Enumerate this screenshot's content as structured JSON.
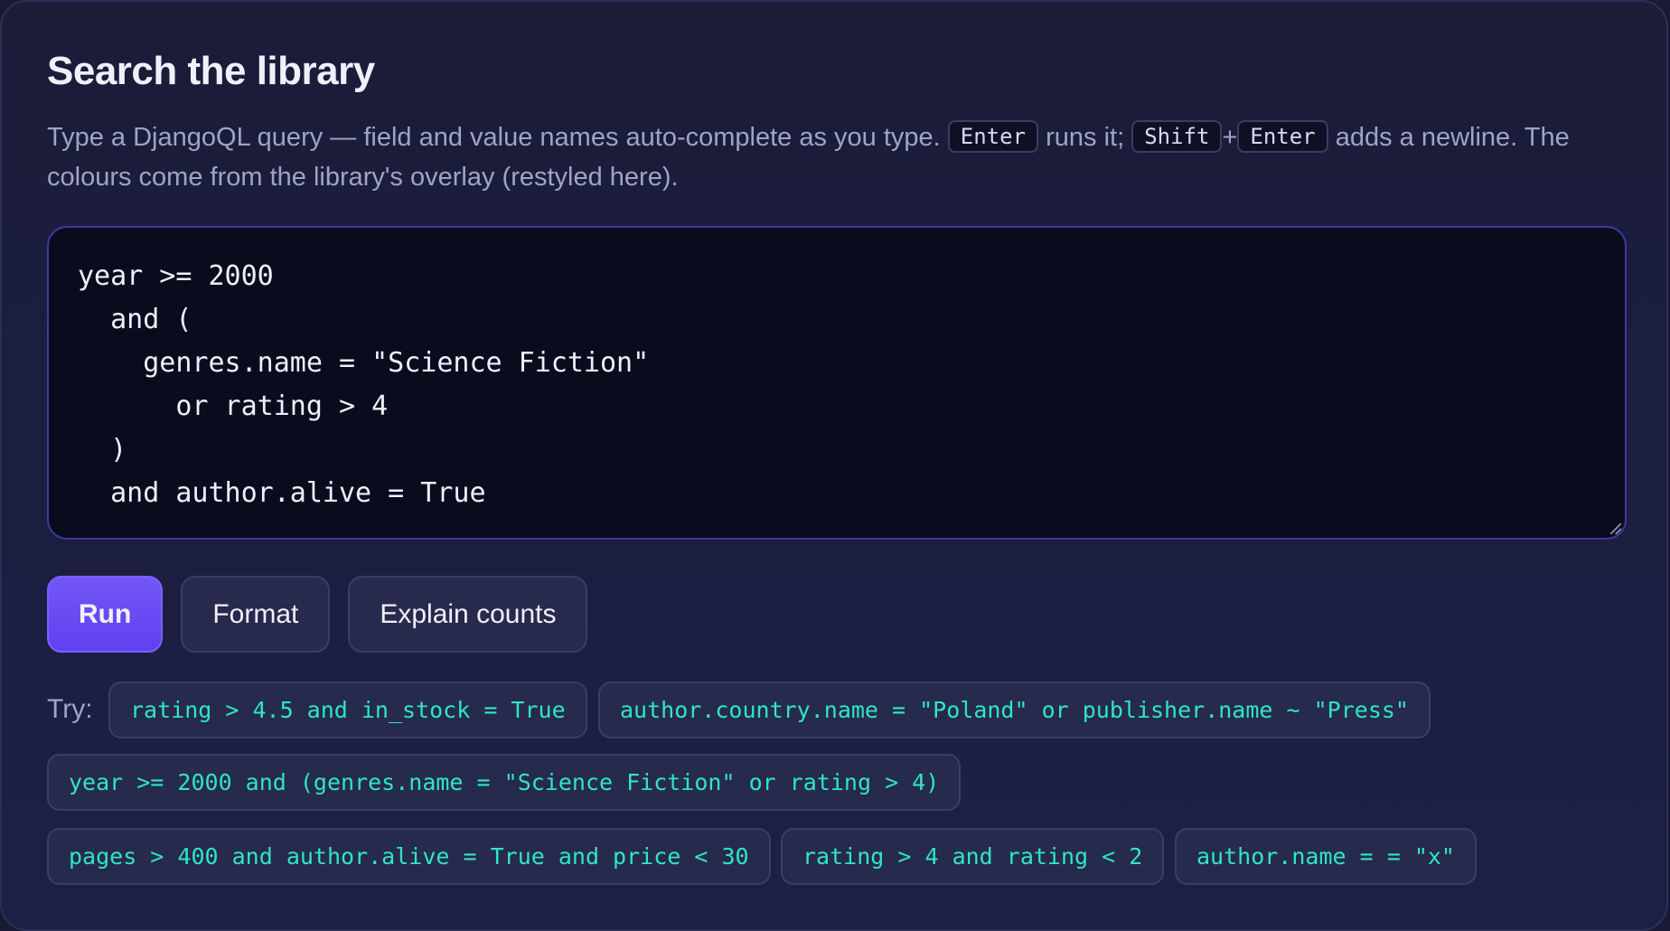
{
  "panel": {
    "title": "Search the library",
    "desc_part1": "Type a DjangoQL query — field and value names auto-complete as you type.",
    "desc_part2": "runs it;",
    "desc_plus": "+",
    "desc_part3": "adds a newline. The colours come from the library's overlay (restyled here).",
    "keys": {
      "enter": "Enter",
      "shift": "Shift"
    }
  },
  "editor": {
    "query": "year >= 2000\n  and (\n    genres.name = \"Science Fiction\"\n      or rating > 4\n  )\n  and author.alive = True"
  },
  "buttons": {
    "run": "Run",
    "format": "Format",
    "explain": "Explain counts"
  },
  "examples": {
    "label": "Try:",
    "items": [
      "rating > 4.5 and in_stock = True",
      "author.country.name = \"Poland\" or publisher.name ~ \"Press\"",
      "year >= 2000 and (genres.name = \"Science Fiction\" or rating > 4)",
      "pages > 400 and author.alive = True and price < 30",
      "rating > 4 and rating < 2",
      "author.name = = \"x\""
    ]
  },
  "colors": {
    "accent": "#6a4cf4",
    "example_text": "#2ee6c3",
    "background": "#1a1c38",
    "editor_bg": "#0a0c1e"
  }
}
